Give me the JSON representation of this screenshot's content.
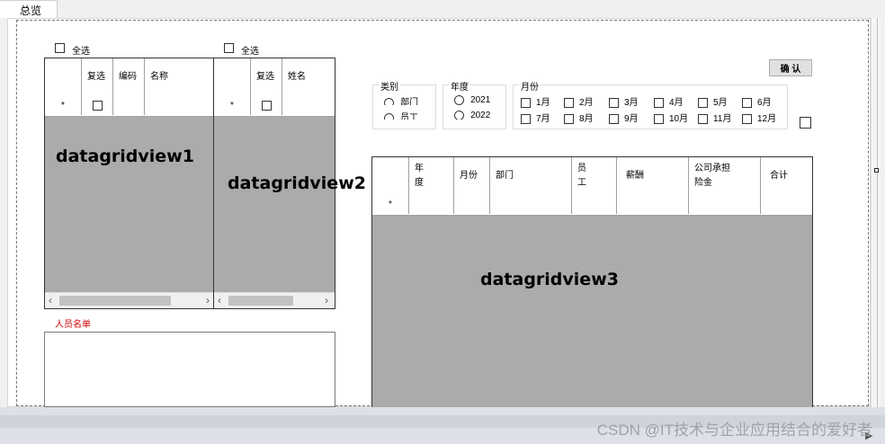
{
  "tab": {
    "label": "总览"
  },
  "grid1": {
    "select_all": "全选",
    "columns": [
      "",
      "复选",
      "编码",
      "名称"
    ],
    "new_row_marker": "*",
    "label": "datagridview1"
  },
  "grid2": {
    "select_all": "全选",
    "columns": [
      "",
      "复选",
      "姓名"
    ],
    "new_row_marker": "*",
    "label": "datagridview2"
  },
  "people_list": {
    "title": "人员名单",
    "title_color": "#d00000"
  },
  "category": {
    "title": "类别",
    "options": [
      "部门",
      "员工"
    ]
  },
  "year": {
    "title": "年度",
    "options": [
      "2021",
      "2022"
    ]
  },
  "month": {
    "title": "月份",
    "months": [
      "1月",
      "2月",
      "3月",
      "4月",
      "5月",
      "6月",
      "7月",
      "8月",
      "9月",
      "10月",
      "11月",
      "12月"
    ]
  },
  "confirm_button": "确 认",
  "grid3": {
    "columns": [
      "",
      "年\n度",
      "月份",
      "部门",
      "员\n工",
      "薪酬",
      "公司承担\n险金",
      "合计"
    ],
    "new_row_marker": "*",
    "label": "datagridview3"
  },
  "watermark": "CSDN @IT技术与企业应用结合的爱好者"
}
